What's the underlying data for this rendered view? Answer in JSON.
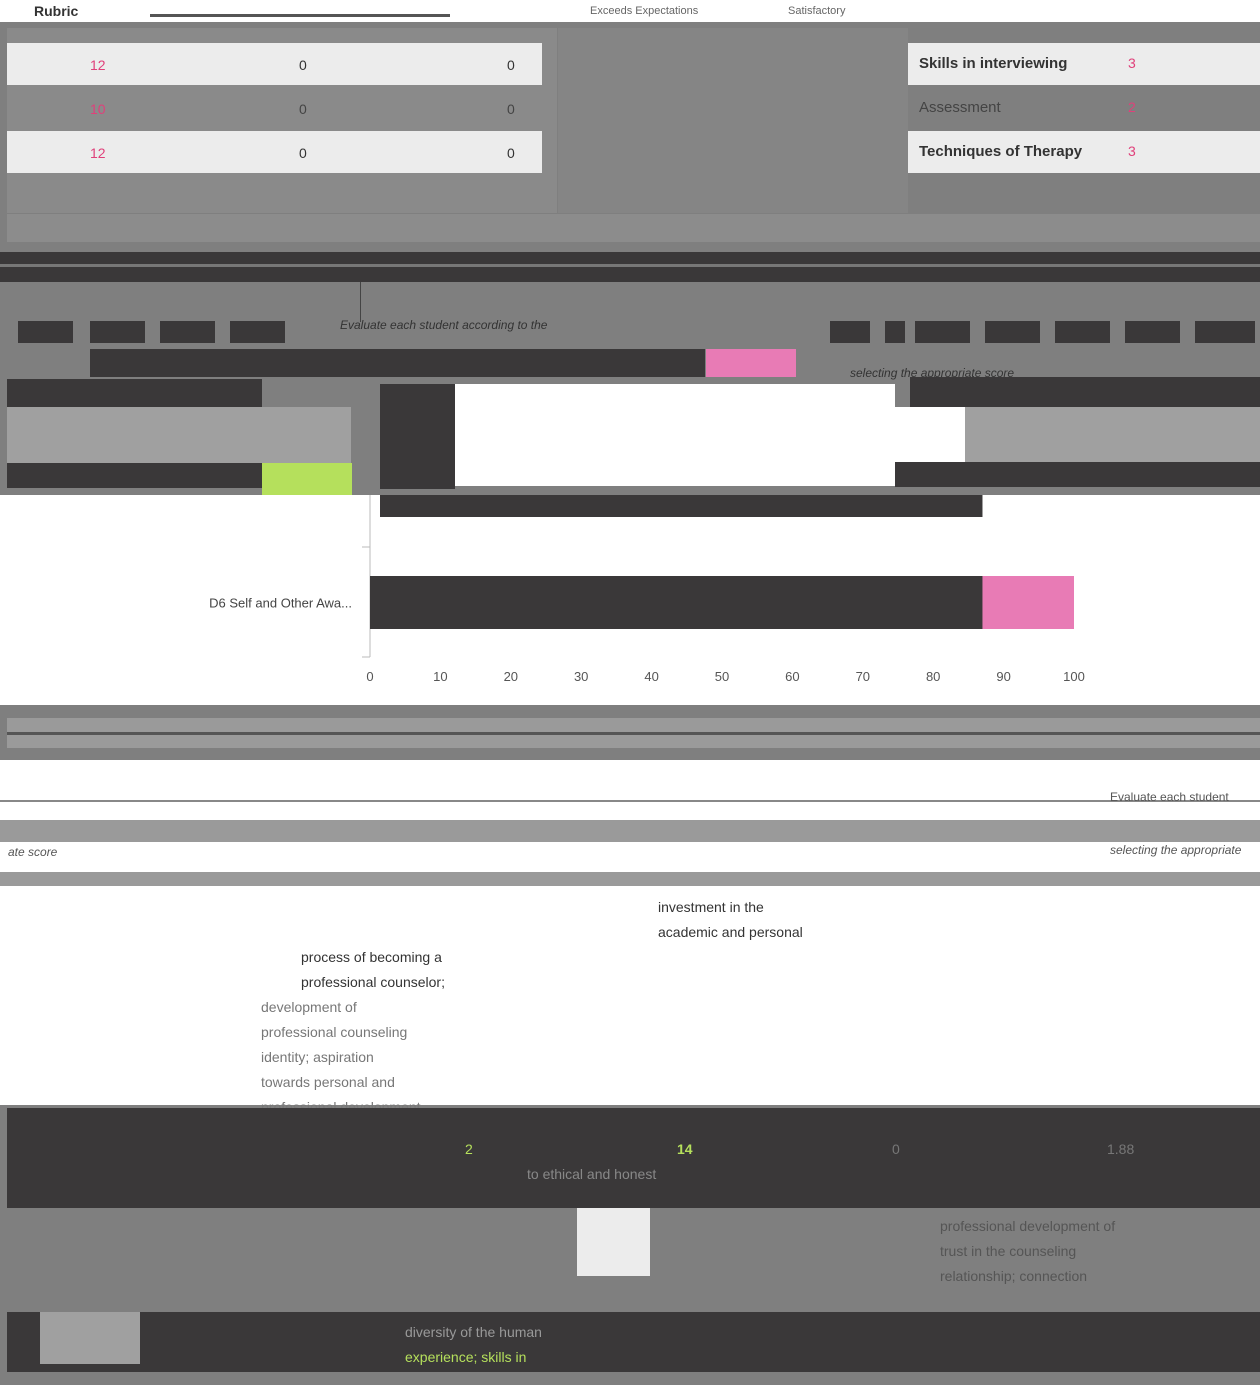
{
  "header": {
    "rubric_label": "Rubric",
    "columns": [
      "Exceeds Expectations",
      "Satisfactory"
    ]
  },
  "table": {
    "rows": [
      {
        "a": "12",
        "b": "0",
        "c": "0"
      },
      {
        "a": "10",
        "b": "0",
        "c": "0"
      },
      {
        "a": "12",
        "b": "0",
        "c": "0"
      }
    ]
  },
  "skills": [
    {
      "label": "Skills in interviewing",
      "value": "3"
    },
    {
      "label": "Assessment",
      "value": "2"
    },
    {
      "label": "Techniques of Therapy",
      "value": "3"
    }
  ],
  "section": {
    "instruction_1": "Evaluate each student according to the",
    "instruction_2": "selecting the appropriate score"
  },
  "chart_data": {
    "type": "bar",
    "orientation": "horizontal",
    "stacked": true,
    "categories": [
      "D6 Self and Other Awa..."
    ],
    "series": [
      {
        "color": "#3a3839",
        "values": [
          87
        ]
      },
      {
        "color": "#e87bb5",
        "values": [
          13
        ]
      }
    ],
    "xlim": [
      0,
      100
    ],
    "xticks": [
      "0",
      "10",
      "20",
      "30",
      "40",
      "50",
      "60",
      "70",
      "80",
      "90",
      "100"
    ]
  },
  "descriptions": {
    "col1_text": [
      "process of becoming a",
      "professional counselor;",
      "development of",
      "professional counseling",
      "identity; aspiration",
      "towards personal and",
      "professional development"
    ],
    "col2_text": [
      "investment in the",
      "academic and personal"
    ],
    "ethical_text": "to ethical and honest",
    "right_text": [
      "professional development of",
      "trust in the counseling",
      "relationship; connection"
    ],
    "bottom_text": [
      "diversity of the human",
      "experience; skills in"
    ],
    "bottom_instruction": "Evaluate each student",
    "bottom_instruction_2": "selecting the appropriate",
    "score_label": "ate score",
    "row_values": [
      "2",
      "14",
      "0",
      "1.88"
    ]
  }
}
